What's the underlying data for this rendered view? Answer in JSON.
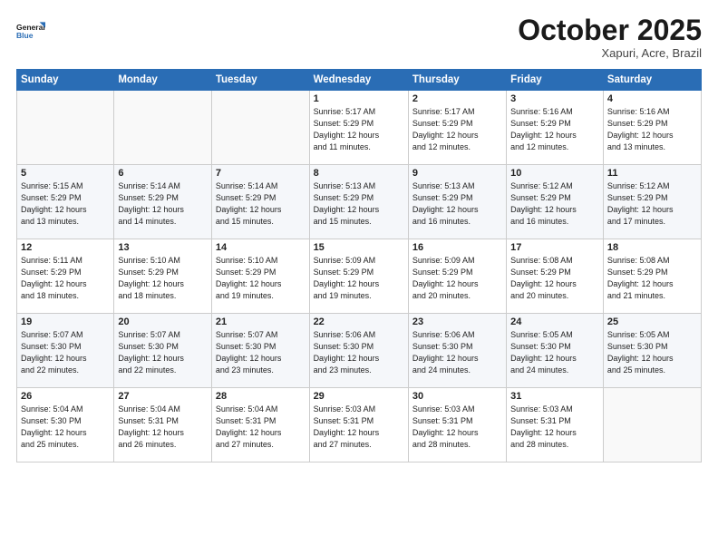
{
  "logo": {
    "line1": "General",
    "line2": "Blue"
  },
  "title": "October 2025",
  "subtitle": "Xapuri, Acre, Brazil",
  "days_header": [
    "Sunday",
    "Monday",
    "Tuesday",
    "Wednesday",
    "Thursday",
    "Friday",
    "Saturday"
  ],
  "weeks": [
    [
      {
        "num": "",
        "info": ""
      },
      {
        "num": "",
        "info": ""
      },
      {
        "num": "",
        "info": ""
      },
      {
        "num": "1",
        "info": "Sunrise: 5:17 AM\nSunset: 5:29 PM\nDaylight: 12 hours\nand 11 minutes."
      },
      {
        "num": "2",
        "info": "Sunrise: 5:17 AM\nSunset: 5:29 PM\nDaylight: 12 hours\nand 12 minutes."
      },
      {
        "num": "3",
        "info": "Sunrise: 5:16 AM\nSunset: 5:29 PM\nDaylight: 12 hours\nand 12 minutes."
      },
      {
        "num": "4",
        "info": "Sunrise: 5:16 AM\nSunset: 5:29 PM\nDaylight: 12 hours\nand 13 minutes."
      }
    ],
    [
      {
        "num": "5",
        "info": "Sunrise: 5:15 AM\nSunset: 5:29 PM\nDaylight: 12 hours\nand 13 minutes."
      },
      {
        "num": "6",
        "info": "Sunrise: 5:14 AM\nSunset: 5:29 PM\nDaylight: 12 hours\nand 14 minutes."
      },
      {
        "num": "7",
        "info": "Sunrise: 5:14 AM\nSunset: 5:29 PM\nDaylight: 12 hours\nand 15 minutes."
      },
      {
        "num": "8",
        "info": "Sunrise: 5:13 AM\nSunset: 5:29 PM\nDaylight: 12 hours\nand 15 minutes."
      },
      {
        "num": "9",
        "info": "Sunrise: 5:13 AM\nSunset: 5:29 PM\nDaylight: 12 hours\nand 16 minutes."
      },
      {
        "num": "10",
        "info": "Sunrise: 5:12 AM\nSunset: 5:29 PM\nDaylight: 12 hours\nand 16 minutes."
      },
      {
        "num": "11",
        "info": "Sunrise: 5:12 AM\nSunset: 5:29 PM\nDaylight: 12 hours\nand 17 minutes."
      }
    ],
    [
      {
        "num": "12",
        "info": "Sunrise: 5:11 AM\nSunset: 5:29 PM\nDaylight: 12 hours\nand 18 minutes."
      },
      {
        "num": "13",
        "info": "Sunrise: 5:10 AM\nSunset: 5:29 PM\nDaylight: 12 hours\nand 18 minutes."
      },
      {
        "num": "14",
        "info": "Sunrise: 5:10 AM\nSunset: 5:29 PM\nDaylight: 12 hours\nand 19 minutes."
      },
      {
        "num": "15",
        "info": "Sunrise: 5:09 AM\nSunset: 5:29 PM\nDaylight: 12 hours\nand 19 minutes."
      },
      {
        "num": "16",
        "info": "Sunrise: 5:09 AM\nSunset: 5:29 PM\nDaylight: 12 hours\nand 20 minutes."
      },
      {
        "num": "17",
        "info": "Sunrise: 5:08 AM\nSunset: 5:29 PM\nDaylight: 12 hours\nand 20 minutes."
      },
      {
        "num": "18",
        "info": "Sunrise: 5:08 AM\nSunset: 5:29 PM\nDaylight: 12 hours\nand 21 minutes."
      }
    ],
    [
      {
        "num": "19",
        "info": "Sunrise: 5:07 AM\nSunset: 5:30 PM\nDaylight: 12 hours\nand 22 minutes."
      },
      {
        "num": "20",
        "info": "Sunrise: 5:07 AM\nSunset: 5:30 PM\nDaylight: 12 hours\nand 22 minutes."
      },
      {
        "num": "21",
        "info": "Sunrise: 5:07 AM\nSunset: 5:30 PM\nDaylight: 12 hours\nand 23 minutes."
      },
      {
        "num": "22",
        "info": "Sunrise: 5:06 AM\nSunset: 5:30 PM\nDaylight: 12 hours\nand 23 minutes."
      },
      {
        "num": "23",
        "info": "Sunrise: 5:06 AM\nSunset: 5:30 PM\nDaylight: 12 hours\nand 24 minutes."
      },
      {
        "num": "24",
        "info": "Sunrise: 5:05 AM\nSunset: 5:30 PM\nDaylight: 12 hours\nand 24 minutes."
      },
      {
        "num": "25",
        "info": "Sunrise: 5:05 AM\nSunset: 5:30 PM\nDaylight: 12 hours\nand 25 minutes."
      }
    ],
    [
      {
        "num": "26",
        "info": "Sunrise: 5:04 AM\nSunset: 5:30 PM\nDaylight: 12 hours\nand 25 minutes."
      },
      {
        "num": "27",
        "info": "Sunrise: 5:04 AM\nSunset: 5:31 PM\nDaylight: 12 hours\nand 26 minutes."
      },
      {
        "num": "28",
        "info": "Sunrise: 5:04 AM\nSunset: 5:31 PM\nDaylight: 12 hours\nand 27 minutes."
      },
      {
        "num": "29",
        "info": "Sunrise: 5:03 AM\nSunset: 5:31 PM\nDaylight: 12 hours\nand 27 minutes."
      },
      {
        "num": "30",
        "info": "Sunrise: 5:03 AM\nSunset: 5:31 PM\nDaylight: 12 hours\nand 28 minutes."
      },
      {
        "num": "31",
        "info": "Sunrise: 5:03 AM\nSunset: 5:31 PM\nDaylight: 12 hours\nand 28 minutes."
      },
      {
        "num": "",
        "info": ""
      }
    ]
  ]
}
